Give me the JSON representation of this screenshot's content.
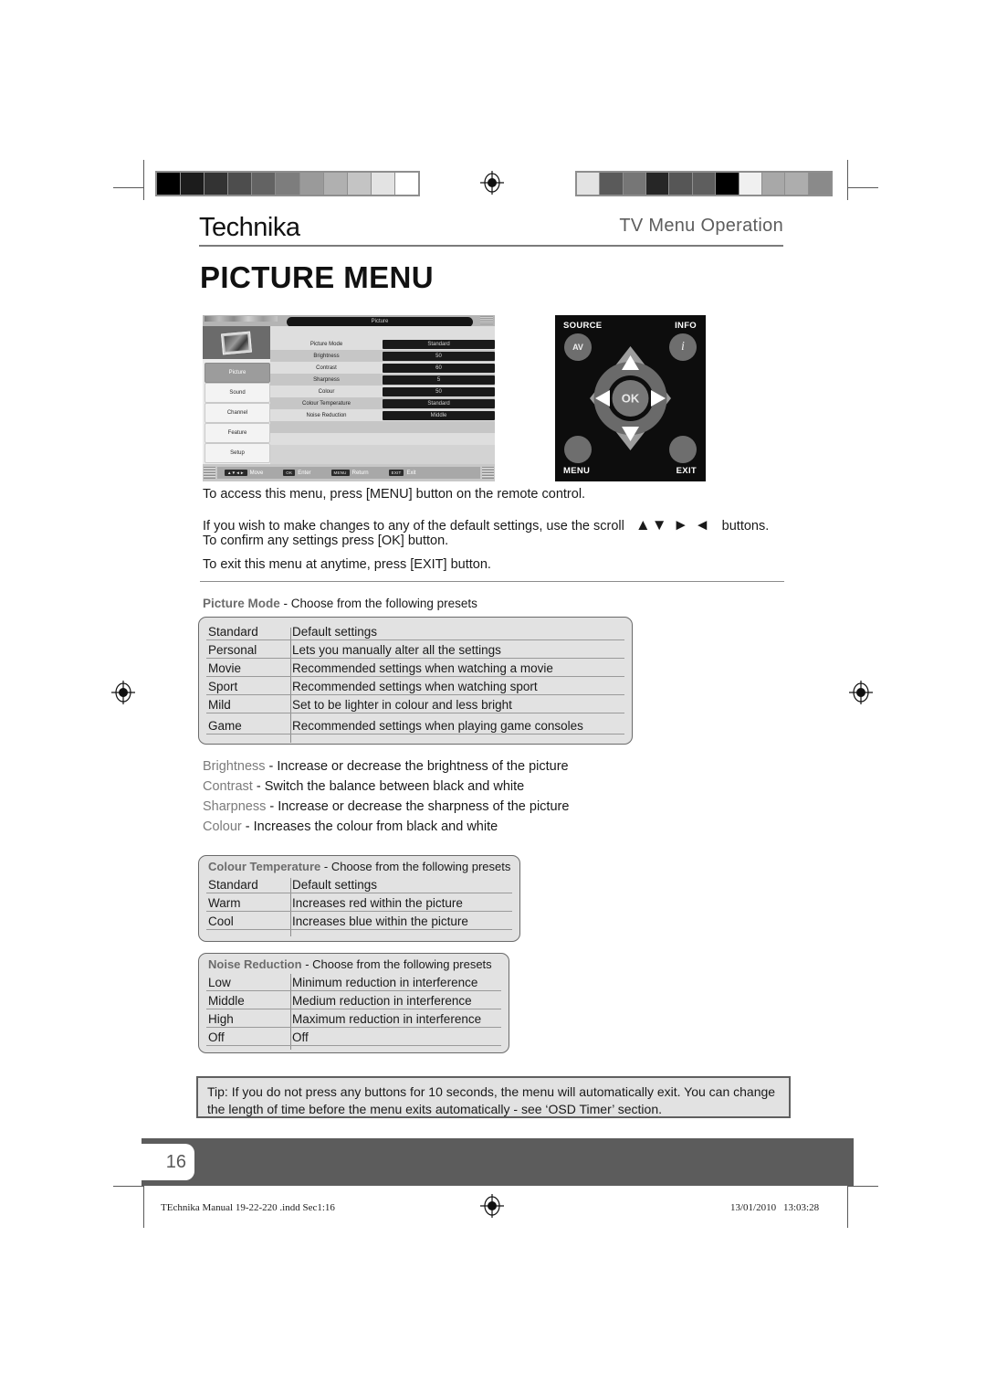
{
  "header": {
    "brand": "Technika",
    "section": "TV Menu Operation",
    "page_title": "PICTURE MENU",
    "left_colorbar": [
      "#000000",
      "#1c1c1c",
      "#333333",
      "#4d4d4d",
      "#636363",
      "#7d7d7d",
      "#9a9a9a",
      "#b0b0b0",
      "#c4c4c4",
      "#e3e3e3",
      "#ffffff"
    ],
    "right_colorbar": [
      "#e3e3e3",
      "#5a5a5a",
      "#767676",
      "#262626",
      "#565656",
      "#5e5e5e",
      "#000000",
      "#f0f0f0",
      "#a8a8a8",
      "#adadad",
      "#8a8a8a"
    ]
  },
  "osd": {
    "title": "Picture",
    "sidebar": [
      "Picture",
      "Sound",
      "Channel",
      "Feature",
      "Setup"
    ],
    "active_sidebar": "Picture",
    "rows": [
      {
        "label": "Picture Mode",
        "value": "Standard"
      },
      {
        "label": "Brightness",
        "value": "50"
      },
      {
        "label": "Contrast",
        "value": "60"
      },
      {
        "label": "Sharpness",
        "value": "5"
      },
      {
        "label": "Colour",
        "value": "50"
      },
      {
        "label": "Colour Temperature",
        "value": "Standard"
      },
      {
        "label": "Noise Reduction",
        "value": "Middle"
      }
    ],
    "hints": [
      {
        "key": "▲▼◄►",
        "label": "Move"
      },
      {
        "key": "OK",
        "label": "Enter"
      },
      {
        "key": "MENU",
        "label": "Return"
      },
      {
        "key": "EXIT",
        "label": "Exit"
      }
    ]
  },
  "remote": {
    "source_label": "SOURCE",
    "info_label": "INFO",
    "menu_label": "MENU",
    "exit_label": "EXIT",
    "av_label": "AV",
    "info_glyph": "i",
    "ok_label": "OK",
    "up_glyph": "▲",
    "down_glyph": "▼",
    "left_glyph": "◄",
    "right_glyph": "►"
  },
  "intro": {
    "line1": "To access this menu, press [MENU] button on the remote control.",
    "line2a": "If you wish to make changes to any of the default settings, use the scroll",
    "line2_glyphs": "▲▼ ► ◄",
    "line2b": "buttons.",
    "line3": "To confirm any settings press [OK] button.",
    "line4": "To exit this menu at anytime, press [EXIT] button."
  },
  "picture_mode_table": {
    "caption_term": "Picture Mode",
    "caption_rest": " - Choose from the following presets",
    "rows": [
      {
        "name": "Standard",
        "desc": "Default settings"
      },
      {
        "name": "Personal",
        "desc": "Lets you manually alter all the settings"
      },
      {
        "name": "Movie",
        "desc": "Recommended settings when watching a movie"
      },
      {
        "name": "Sport",
        "desc": "Recommended settings when watching sport"
      },
      {
        "name": "Mild",
        "desc": "Set to be lighter in colour and less bright"
      },
      {
        "name": "Game",
        "desc": "Recommended settings when playing game consoles"
      }
    ]
  },
  "definitions": [
    {
      "term": "Brightness",
      "desc": " - Increase or decrease the brightness of the picture"
    },
    {
      "term": "Contrast",
      "desc": " - Switch the balance between black and white"
    },
    {
      "term": "Sharpness",
      "desc": " - Increase or decrease the sharpness of the picture"
    },
    {
      "term": "Colour",
      "desc": " - Increases the colour from black and white"
    }
  ],
  "colour_temp_table": {
    "caption_term": "Colour Temperature",
    "caption_rest": " - Choose from the following presets",
    "rows": [
      {
        "name": "Standard",
        "desc": "Default settings"
      },
      {
        "name": "Warm",
        "desc": "Increases red within the picture"
      },
      {
        "name": "Cool",
        "desc": "Increases blue within the picture"
      }
    ]
  },
  "noise_reduction_table": {
    "caption_term": "Noise Reduction",
    "caption_rest": " - Choose from the following presets",
    "rows": [
      {
        "name": "Low",
        "desc": "Minimum reduction in interference"
      },
      {
        "name": "Middle",
        "desc": "Medium reduction in interference"
      },
      {
        "name": "High",
        "desc": "Maximum reduction in interference"
      },
      {
        "name": "Off",
        "desc": "Off"
      }
    ]
  },
  "tip": {
    "text": "Tip: If you do not press any buttons for 10 seconds, the menu will automatically exit. You can change the length of time before the menu exits automatically - see ‘OSD Timer’ section."
  },
  "footer": {
    "page_number": "16",
    "file_name": "TEchnika Manual 19-22-220 .indd   Sec1:16",
    "date": "13/01/2010",
    "time": "13:03:28"
  }
}
